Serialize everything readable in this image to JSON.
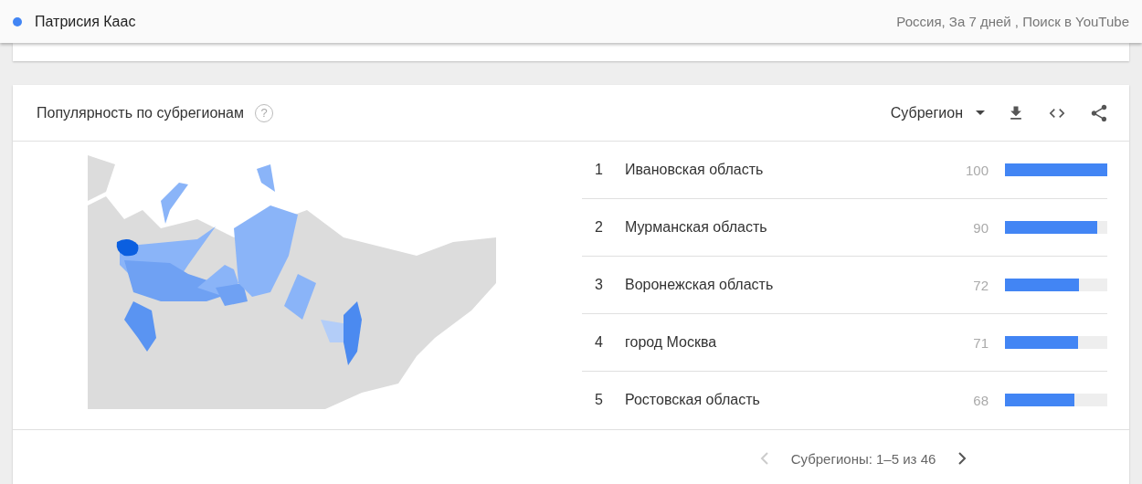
{
  "top_bar": {
    "term": {
      "label": "Патрисия Каас",
      "color": "#4285f4"
    },
    "filters": "Россия, За 7 дней , Поиск в YouTube"
  },
  "card": {
    "title": "Популярность по субрегионам",
    "help_icon": "?",
    "resolution": "Субрегион",
    "rows": [
      {
        "rank": "1",
        "name": "Ивановская область",
        "value": "100",
        "level": 1.0
      },
      {
        "rank": "2",
        "name": "Мурманская область",
        "value": "90",
        "level": 0.9
      },
      {
        "rank": "3",
        "name": "Воронежская область",
        "value": "72",
        "level": 0.72
      },
      {
        "rank": "4",
        "name": "город Москва",
        "value": "71",
        "level": 0.71
      },
      {
        "rank": "5",
        "name": "Ростовская область",
        "value": "68",
        "level": 0.68
      }
    ],
    "pagination": {
      "label": "Субрегионы: 1–5 из 46",
      "prev_disabled": true,
      "next_disabled": false
    }
  }
}
